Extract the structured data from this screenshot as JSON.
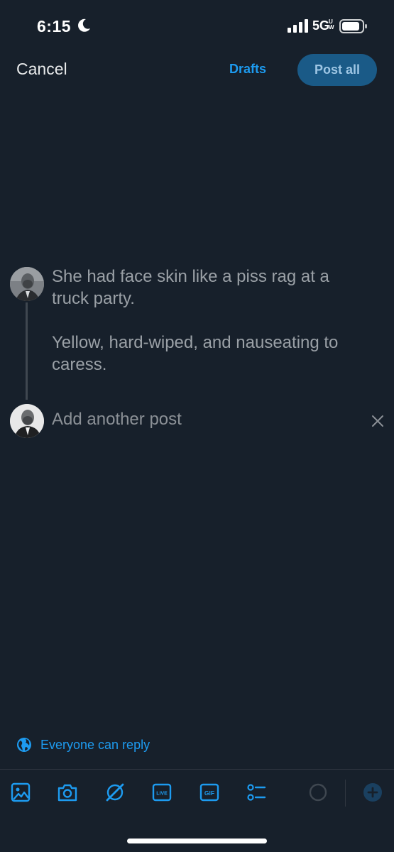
{
  "status_bar": {
    "time": "6:15",
    "network": "5G",
    "network_suffix": "UW"
  },
  "header": {
    "cancel_label": "Cancel",
    "drafts_label": "Drafts",
    "post_all_label": "Post all"
  },
  "thread": {
    "posts": [
      {
        "paragraphs": [
          "She had face skin like a piss rag at a truck party.",
          "Yellow, hard-wiped, and nauseating to caress."
        ]
      }
    ],
    "add_another_placeholder": "Add another post"
  },
  "reply_setting": {
    "label": "Everyone can reply"
  },
  "toolbar": {
    "icons": [
      "image-icon",
      "camera-icon",
      "grok-icon",
      "live-icon",
      "gif-icon",
      "poll-icon",
      "character-count-circle",
      "add-post-icon"
    ],
    "gif_text": "GIF",
    "live_text": "LIVE"
  },
  "colors": {
    "background": "#17202b",
    "accent": "#1d9bf0",
    "post_button": "#1a5a87"
  }
}
